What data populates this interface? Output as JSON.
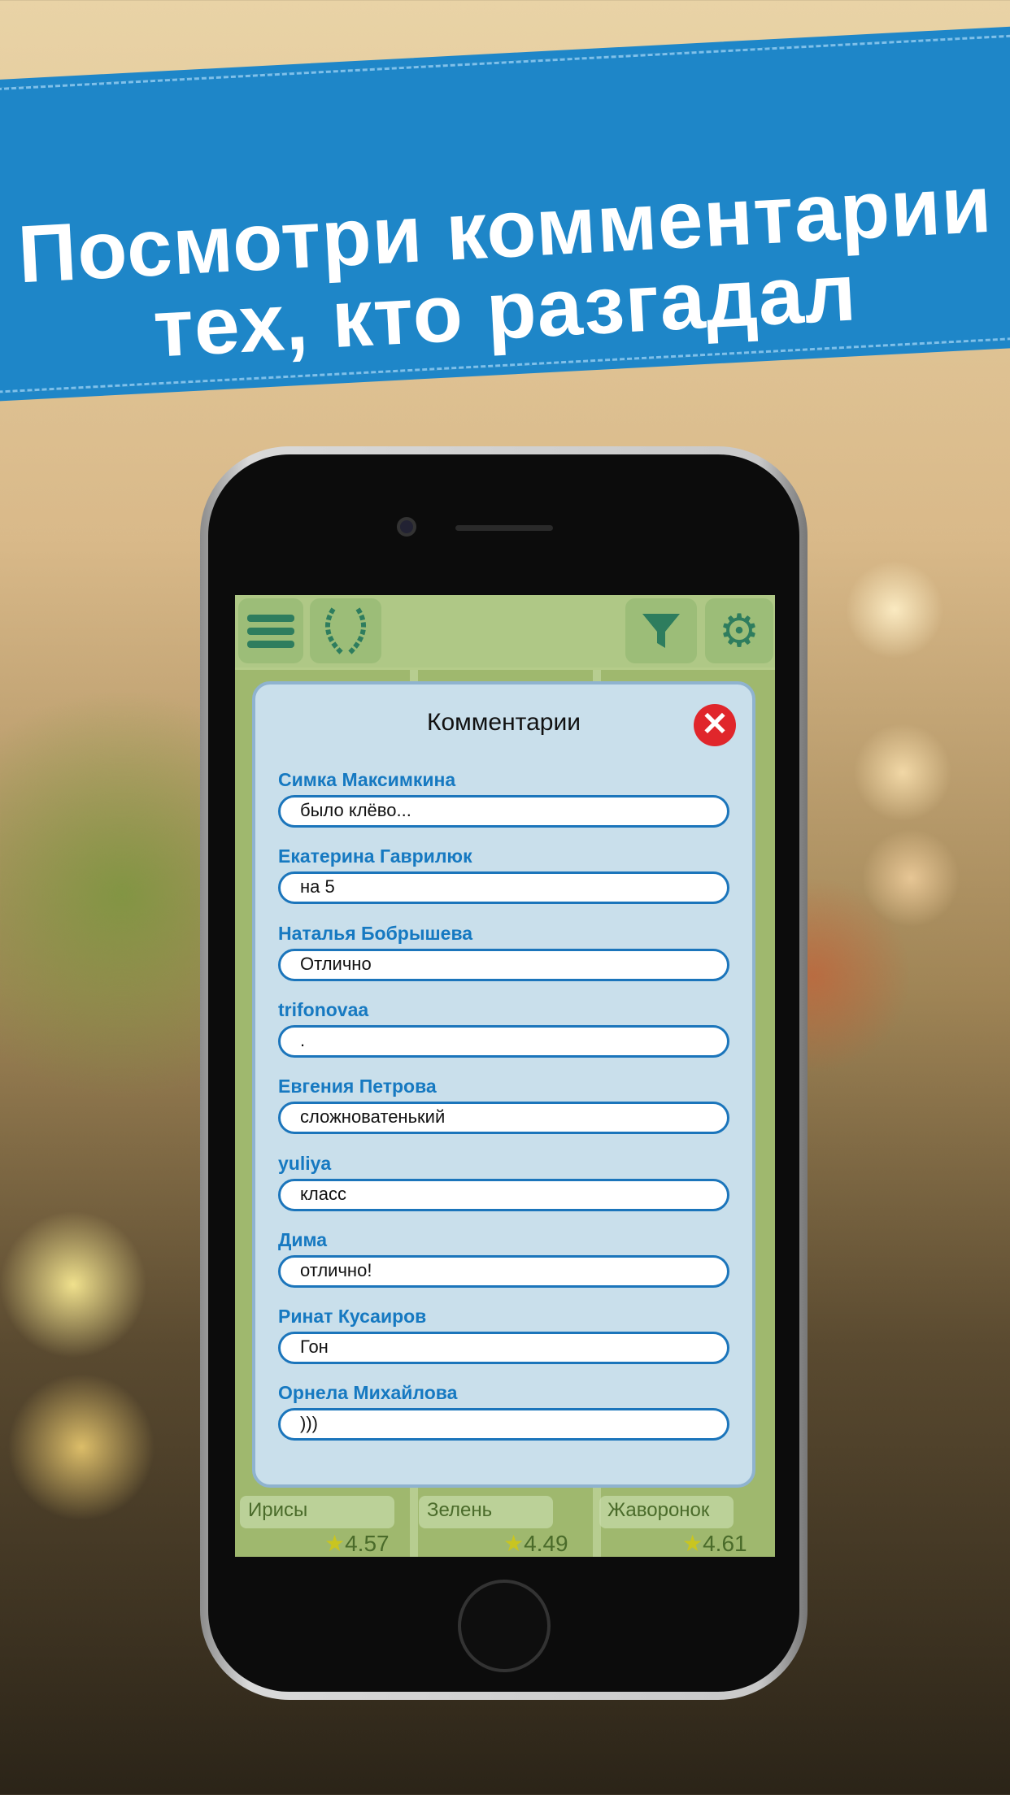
{
  "banner": {
    "line1": "Посмотри комментарии",
    "line2": "тех, кто разгадал",
    "color": "#1e86c8"
  },
  "app": {
    "topbar": {
      "icons": [
        "menu-icon",
        "laurel-icon",
        "filter-icon",
        "gear-icon"
      ]
    },
    "tiles": [
      {
        "label": "Ирисы",
        "rating": "4.57"
      },
      {
        "label": "Зелень",
        "rating": "4.49"
      },
      {
        "label": "Жаворонок",
        "rating": "4.61"
      }
    ],
    "dialog": {
      "title": "Комментарии",
      "close_icon": "close-icon",
      "comments": [
        {
          "name": "Симка Максимкина",
          "text": "было клёво..."
        },
        {
          "name": "Екатерина Гаврилюк",
          "text": "на 5"
        },
        {
          "name": "Наталья Бобрышева",
          "text": "Отлично"
        },
        {
          "name": "trifonovaa",
          "text": "."
        },
        {
          "name": "Евгения Петрова",
          "text": "сложноватенький"
        },
        {
          "name": "yuliya",
          "text": "класс"
        },
        {
          "name": "Дима",
          "text": "отлично!"
        },
        {
          "name": "Ринат Кусаиров",
          "text": "Гон"
        },
        {
          "name": "Орнела Михайлова",
          "text": ")))"
        }
      ]
    }
  }
}
